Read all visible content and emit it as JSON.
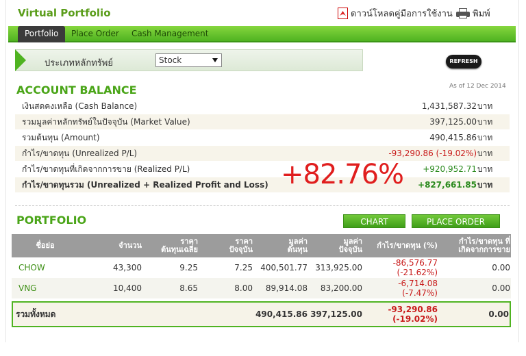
{
  "app": {
    "title": "Virtual Portfolio"
  },
  "top_links": {
    "manual": "ดาวน์โหลดคู่มือการใช้งาน",
    "print": "พิมพ์"
  },
  "nav": {
    "tabs": [
      "Portfolio",
      "Place Order",
      "Cash Management"
    ],
    "active": "Portfolio"
  },
  "filter": {
    "label": "ประเภทหลักทรัพย์",
    "selected": "Stock"
  },
  "refresh_label": "REFRESH",
  "account": {
    "title": "ACCOUNT BALANCE",
    "as_of": "As of 12 Dec 2014",
    "unit": "บาท",
    "rows": [
      {
        "label": "เงินสดคงเหลือ (Cash Balance)",
        "value": "1,431,587.32"
      },
      {
        "label": "รวมมูลค่าหลักทรัพย์ในปัจจุบัน (Market Value)",
        "value": "397,125.00"
      },
      {
        "label": "รวมต้นทุน (Amount)",
        "value": "490,415.86"
      },
      {
        "label": "กำไร/ขาดทุน (Unrealized P/L)",
        "value": "-93,290.86 (-19.02%)"
      },
      {
        "label": "กำไร/ขาดทุนที่เกิดจากการขาย (Realized P/L)",
        "value": "+920,952.71"
      },
      {
        "label": "กำไร/ขาดทุนรวม (Unrealized + Realized Profit and Loss)",
        "value": "+827,661.85"
      }
    ],
    "total_pct": "+82.76%"
  },
  "portfolio": {
    "title": "PORTFOLIO",
    "chart_button": "CHART",
    "place_order_button": "PLACE ORDER",
    "columns": {
      "symbol": "ชื่อย่อ",
      "qty": "จำนวน",
      "avg_cost_1": "ราคา",
      "avg_cost_2": "ต้นทุนเฉลี่ย",
      "price_1": "ราคา",
      "price_2": "ปัจจุบัน",
      "cost_1": "มูลค่า",
      "cost_2": "ต้นทุน",
      "mkt_1": "มูลค่า",
      "mkt_2": "ปัจจุบัน",
      "upl": "กำไร/ขาดทุน (%)",
      "rpl_1": "กำไร/ขาดทุน ที่",
      "rpl_2": "เกิดจากการขาย"
    },
    "rows": [
      {
        "symbol": "CHOW",
        "qty": "43,300",
        "avg_cost": "9.25",
        "price": "7.25",
        "cost": "400,501.77",
        "market": "313,925.00",
        "upl": "-86,576.77",
        "upl_pct": "(-21.62%)",
        "rpl": "0.00"
      },
      {
        "symbol": "VNG",
        "qty": "10,400",
        "avg_cost": "8.65",
        "price": "8.00",
        "cost": "89,914.08",
        "market": "83,200.00",
        "upl": "-6,714.08",
        "upl_pct": "(-7.47%)",
        "rpl": "0.00"
      }
    ],
    "total": {
      "label": "รวมทั้งหมด",
      "cost": "490,415.86",
      "market": "397,125.00",
      "upl": "-93,290.86",
      "upl_pct": "(-19.02%)",
      "rpl": "0.00"
    }
  }
}
